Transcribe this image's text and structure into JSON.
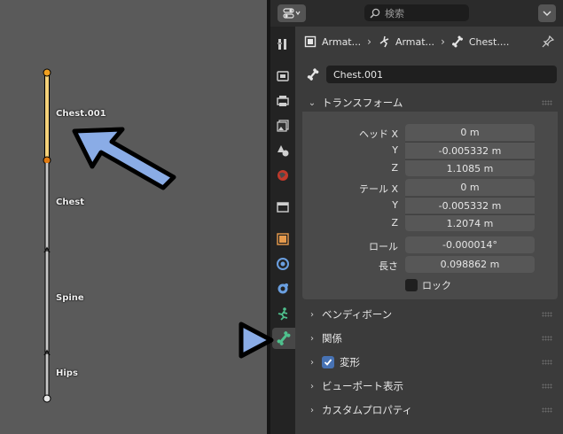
{
  "viewport": {
    "bones": [
      {
        "name": "Chest.001"
      },
      {
        "name": "Chest"
      },
      {
        "name": "Spine"
      },
      {
        "name": "Hips"
      }
    ],
    "colors": {
      "background": "#5a5a5a",
      "selected_bone": "#f5d27a",
      "bone": "#c8c8c8"
    }
  },
  "header": {
    "editor_type_icon": "properties-editor-icon",
    "search_placeholder": "検索",
    "menu_icon": "chevron-down-icon"
  },
  "tabs": [
    {
      "name": "tool-tab",
      "icon": "wrench-screwdriver-icon"
    },
    {
      "name": "render-tab",
      "icon": "camera-back-icon"
    },
    {
      "name": "output-tab",
      "icon": "printer-icon"
    },
    {
      "name": "view-layer-tab",
      "icon": "image-stack-icon"
    },
    {
      "name": "scene-tab",
      "icon": "cone-sphere-icon"
    },
    {
      "name": "world-tab",
      "icon": "globe-icon"
    },
    {
      "name": "collection-tab",
      "icon": "box-icon"
    },
    {
      "name": "object-tab",
      "icon": "orange-square-icon"
    },
    {
      "name": "modifier-tab",
      "icon": "wrench-blue-icon"
    },
    {
      "name": "physics-tab",
      "icon": "circle-orbit-icon"
    },
    {
      "name": "object-data-tab",
      "icon": "running-figure-icon"
    },
    {
      "name": "bone-tab",
      "icon": "bone-icon",
      "active": true
    }
  ],
  "breadcrumb": {
    "items": [
      "Armat...",
      "Armat...",
      "Chest...."
    ],
    "pin_icon": "pin-icon"
  },
  "bone_name": "Chest.001",
  "transform": {
    "title": "トランスフォーム",
    "head_label": "ヘッド X",
    "tail_label": "テール X",
    "y_label": "Y",
    "z_label": "Z",
    "head": {
      "x": "0 m",
      "y": "-0.005332 m",
      "z": "1.1085 m"
    },
    "tail": {
      "x": "0 m",
      "y": "-0.005332 m",
      "z": "1.2074 m"
    },
    "roll_label": "ロール",
    "roll": "-0.000014°",
    "length_label": "長さ",
    "length": "0.098862 m",
    "lock_label": "ロック",
    "lock_checked": false
  },
  "panels": {
    "bendy_bones": "ベンディボーン",
    "relations": "関係",
    "deform": "変形",
    "deform_checked": true,
    "viewport_display": "ビューポート表示",
    "custom_properties": "カスタムプロパティ"
  },
  "annotations": {
    "viewport_arrow_color": "#8aace6",
    "tab_arrow_color": "#8aace6"
  }
}
